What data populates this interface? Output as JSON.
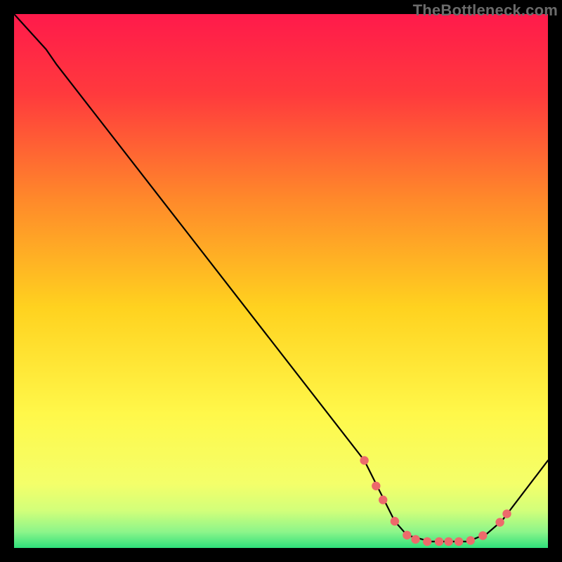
{
  "attribution": "TheBottleneck.com",
  "chart_data": {
    "type": "line",
    "xlim": [
      0,
      100
    ],
    "ylim": [
      0,
      100
    ],
    "gradient_colors": {
      "top": "#ff1a4b",
      "upper_mid": "#ff7a2e",
      "mid": "#ffd21f",
      "lower_mid": "#fff84a",
      "bottom": "#2fe07b"
    },
    "curve": [
      {
        "x": 0,
        "y": 100
      },
      {
        "x": 6,
        "y": 93.4
      },
      {
        "x": 8,
        "y": 90.5
      },
      {
        "x": 65.6,
        "y": 16.4
      },
      {
        "x": 71.3,
        "y": 5.0
      },
      {
        "x": 73.6,
        "y": 2.4
      },
      {
        "x": 78.0,
        "y": 1.2
      },
      {
        "x": 85.0,
        "y": 1.2
      },
      {
        "x": 88.6,
        "y": 2.7
      },
      {
        "x": 91.4,
        "y": 5.1
      },
      {
        "x": 100,
        "y": 16.4
      }
    ],
    "markers": [
      {
        "x": 65.6,
        "y": 16.4
      },
      {
        "x": 67.8,
        "y": 11.6
      },
      {
        "x": 69.1,
        "y": 9.0
      },
      {
        "x": 71.3,
        "y": 5.0
      },
      {
        "x": 73.6,
        "y": 2.4
      },
      {
        "x": 75.2,
        "y": 1.6
      },
      {
        "x": 77.4,
        "y": 1.2
      },
      {
        "x": 79.6,
        "y": 1.2
      },
      {
        "x": 81.4,
        "y": 1.2
      },
      {
        "x": 83.3,
        "y": 1.2
      },
      {
        "x": 85.5,
        "y": 1.4
      },
      {
        "x": 87.8,
        "y": 2.3
      },
      {
        "x": 91.0,
        "y": 4.8
      },
      {
        "x": 92.3,
        "y": 6.4
      }
    ],
    "marker_color": "#ed6a6b",
    "curve_color": "#000000",
    "title": "",
    "xlabel": "",
    "ylabel": ""
  }
}
